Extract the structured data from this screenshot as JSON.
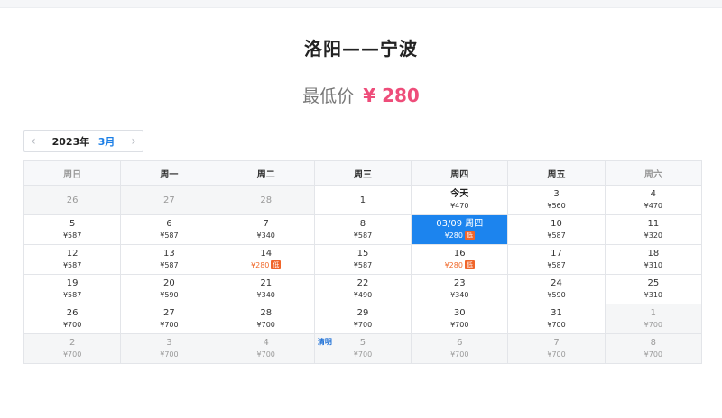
{
  "header": {
    "route": "洛阳——宁波",
    "lowest_label": "最低价",
    "lowest_price": "¥ 280"
  },
  "month_nav": {
    "prev_icon": "‹",
    "next_icon": "›",
    "year": "2023年",
    "month": "3月"
  },
  "weekdays": [
    "周日",
    "周一",
    "周二",
    "周三",
    "周四",
    "周五",
    "周六"
  ],
  "low_badge": "低",
  "weeks": [
    [
      {
        "day": "26",
        "price": "",
        "other": true
      },
      {
        "day": "27",
        "price": "",
        "other": true
      },
      {
        "day": "28",
        "price": "",
        "other": true
      },
      {
        "day": "1",
        "price": ""
      },
      {
        "day": "今天",
        "price": "¥470",
        "today": true
      },
      {
        "day": "3",
        "price": "¥560"
      },
      {
        "day": "4",
        "price": "¥470"
      }
    ],
    [
      {
        "day": "5",
        "price": "¥587"
      },
      {
        "day": "6",
        "price": "¥587"
      },
      {
        "day": "7",
        "price": "¥340"
      },
      {
        "day": "8",
        "price": "¥587"
      },
      {
        "day": "03/09 周四",
        "price": "¥280",
        "low": true,
        "selected": true
      },
      {
        "day": "10",
        "price": "¥587"
      },
      {
        "day": "11",
        "price": "¥320"
      }
    ],
    [
      {
        "day": "12",
        "price": "¥587"
      },
      {
        "day": "13",
        "price": "¥587"
      },
      {
        "day": "14",
        "price": "¥280",
        "low": true
      },
      {
        "day": "15",
        "price": "¥587"
      },
      {
        "day": "16",
        "price": "¥280",
        "low": true
      },
      {
        "day": "17",
        "price": "¥587"
      },
      {
        "day": "18",
        "price": "¥310"
      }
    ],
    [
      {
        "day": "19",
        "price": "¥587"
      },
      {
        "day": "20",
        "price": "¥590"
      },
      {
        "day": "21",
        "price": "¥340"
      },
      {
        "day": "22",
        "price": "¥490"
      },
      {
        "day": "23",
        "price": "¥340"
      },
      {
        "day": "24",
        "price": "¥590"
      },
      {
        "day": "25",
        "price": "¥310"
      }
    ],
    [
      {
        "day": "26",
        "price": "¥700"
      },
      {
        "day": "27",
        "price": "¥700"
      },
      {
        "day": "28",
        "price": "¥700"
      },
      {
        "day": "29",
        "price": "¥700"
      },
      {
        "day": "30",
        "price": "¥700"
      },
      {
        "day": "31",
        "price": "¥700"
      },
      {
        "day": "1",
        "price": "¥700",
        "other": true
      }
    ],
    [
      {
        "day": "2",
        "price": "¥700",
        "other": true
      },
      {
        "day": "3",
        "price": "¥700",
        "other": true
      },
      {
        "day": "4",
        "price": "¥700",
        "other": true
      },
      {
        "day": "5",
        "price": "¥700",
        "other": true,
        "holiday": "清明"
      },
      {
        "day": "6",
        "price": "¥700",
        "other": true
      },
      {
        "day": "7",
        "price": "¥700",
        "other": true
      },
      {
        "day": "8",
        "price": "¥700",
        "other": true
      }
    ]
  ]
}
